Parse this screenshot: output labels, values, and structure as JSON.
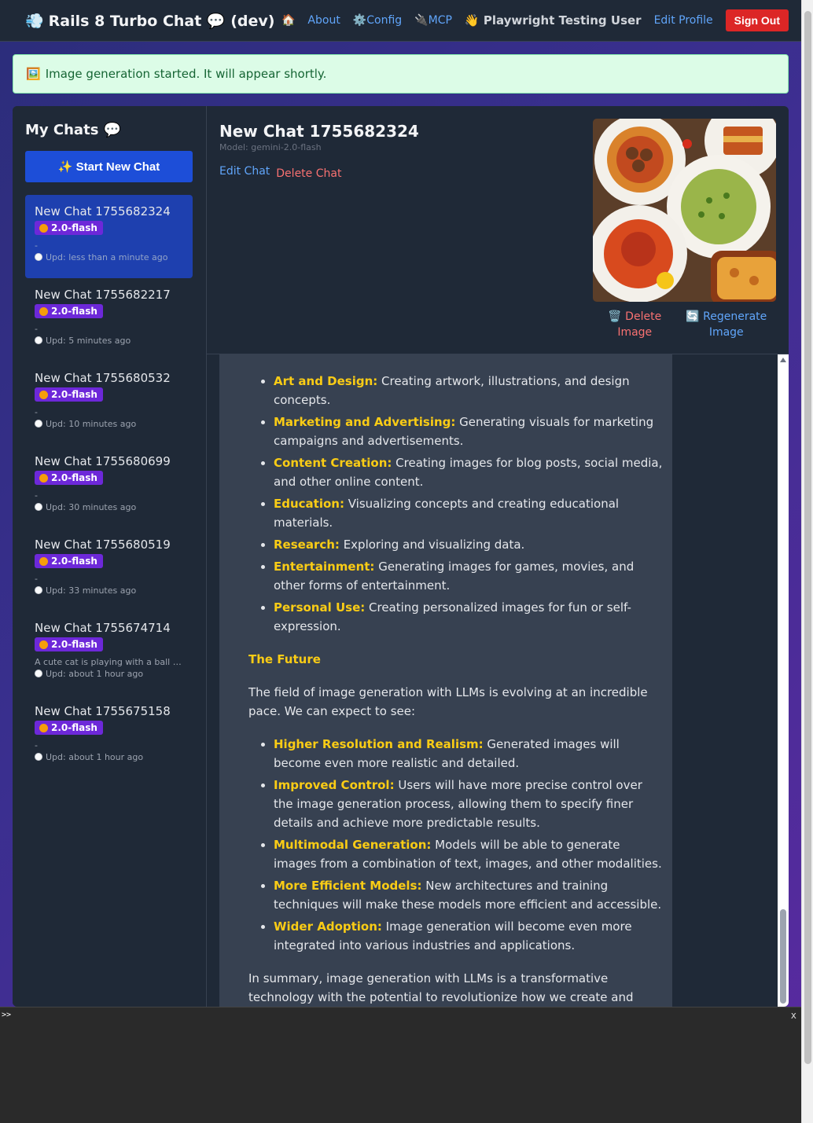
{
  "header": {
    "app_title": "Rails 8 Turbo Chat 💬 (dev)",
    "nav": {
      "home": "🏠",
      "about": "About",
      "config": "⚙️Config",
      "mcp": "🔌MCP",
      "user": "👋 Playwright Testing User",
      "edit_profile": "Edit Profile",
      "sign_out": "Sign Out"
    }
  },
  "flash": {
    "message": "Image generation started. It will appear shortly."
  },
  "sidebar": {
    "title": "My Chats 💬",
    "new_chat": "✨ Start New Chat",
    "chats": [
      {
        "name": "New Chat 1755682324",
        "model": "2.0-flash",
        "snippet": "-",
        "updated": "Upd: less than a minute ago",
        "active": true
      },
      {
        "name": "New Chat 1755682217",
        "model": "2.0-flash",
        "snippet": "-",
        "updated": "Upd: 5 minutes ago"
      },
      {
        "name": "New Chat 1755680532",
        "model": "2.0-flash",
        "snippet": "-",
        "updated": "Upd: 10 minutes ago"
      },
      {
        "name": "New Chat 1755680699",
        "model": "2.0-flash",
        "snippet": "-",
        "updated": "Upd: 30 minutes ago"
      },
      {
        "name": "New Chat 1755680519",
        "model": "2.0-flash",
        "snippet": "-",
        "updated": "Upd: 33 minutes ago"
      },
      {
        "name": "New Chat 1755674714",
        "model": "2.0-flash",
        "snippet": "A cute cat is playing with a ball of...",
        "updated": "Upd: about 1 hour ago"
      },
      {
        "name": "New Chat 1755675158",
        "model": "2.0-flash",
        "snippet": "-",
        "updated": "Upd: about 1 hour ago"
      }
    ]
  },
  "chat": {
    "title": "New Chat 1755682324",
    "model": "Model: gemini-2.0-flash",
    "edit": "Edit Chat",
    "delete": "Delete Chat",
    "delete_image": "🗑️ Delete Image",
    "regenerate_image": "🔄 Regenerate Image"
  },
  "message": {
    "applications": [
      {
        "term": "Art and Design:",
        "text": " Creating artwork, illustrations, and design concepts."
      },
      {
        "term": "Marketing and Advertising:",
        "text": " Generating visuals for marketing campaigns and advertisements."
      },
      {
        "term": "Content Creation:",
        "text": " Creating images for blog posts, social media, and other online content."
      },
      {
        "term": "Education:",
        "text": " Visualizing concepts and creating educational materials."
      },
      {
        "term": "Research:",
        "text": " Exploring and visualizing data."
      },
      {
        "term": "Entertainment:",
        "text": " Generating images for games, movies, and other forms of entertainment."
      },
      {
        "term": "Personal Use:",
        "text": " Creating personalized images for fun or self-expression."
      }
    ],
    "future_heading": "The Future",
    "future_intro": "The field of image generation with LLMs is evolving at an incredible pace. We can expect to see:",
    "future": [
      {
        "term": "Higher Resolution and Realism:",
        "text": " Generated images will become even more realistic and detailed."
      },
      {
        "term": "Improved Control:",
        "text": " Users will have more precise control over the image generation process, allowing them to specify finer details and achieve more predictable results."
      },
      {
        "term": "Multimodal Generation:",
        "text": " Models will be able to generate images from a combination of text, images, and other modalities."
      },
      {
        "term": "More Efficient Models:",
        "text": " New architectures and training techniques will make these models more efficient and accessible."
      },
      {
        "term": "Wider Adoption:",
        "text": " Image generation will become even more integrated into various industries and applications."
      }
    ],
    "summary": "In summary, image generation with LLMs is a transformative technology with the potential to revolutionize how we create and interact with visual content. It’s important to be aware of both its incredible potential and its ethical challenges as it continues to develop."
  },
  "console": {
    "prompt": ">>",
    "close": "x"
  }
}
